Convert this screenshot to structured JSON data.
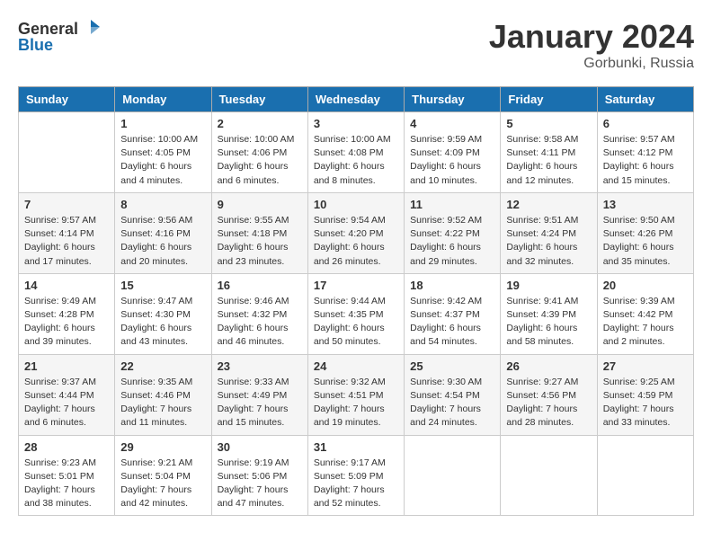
{
  "header": {
    "logo_general": "General",
    "logo_blue": "Blue",
    "month_year": "January 2024",
    "location": "Gorbunki, Russia"
  },
  "days_of_week": [
    "Sunday",
    "Monday",
    "Tuesday",
    "Wednesday",
    "Thursday",
    "Friday",
    "Saturday"
  ],
  "weeks": [
    [
      {
        "day": "",
        "sunrise": "",
        "sunset": "",
        "daylight": ""
      },
      {
        "day": "1",
        "sunrise": "Sunrise: 10:00 AM",
        "sunset": "Sunset: 4:05 PM",
        "daylight": "Daylight: 6 hours and 4 minutes."
      },
      {
        "day": "2",
        "sunrise": "Sunrise: 10:00 AM",
        "sunset": "Sunset: 4:06 PM",
        "daylight": "Daylight: 6 hours and 6 minutes."
      },
      {
        "day": "3",
        "sunrise": "Sunrise: 10:00 AM",
        "sunset": "Sunset: 4:08 PM",
        "daylight": "Daylight: 6 hours and 8 minutes."
      },
      {
        "day": "4",
        "sunrise": "Sunrise: 9:59 AM",
        "sunset": "Sunset: 4:09 PM",
        "daylight": "Daylight: 6 hours and 10 minutes."
      },
      {
        "day": "5",
        "sunrise": "Sunrise: 9:58 AM",
        "sunset": "Sunset: 4:11 PM",
        "daylight": "Daylight: 6 hours and 12 minutes."
      },
      {
        "day": "6",
        "sunrise": "Sunrise: 9:57 AM",
        "sunset": "Sunset: 4:12 PM",
        "daylight": "Daylight: 6 hours and 15 minutes."
      }
    ],
    [
      {
        "day": "7",
        "sunrise": "Sunrise: 9:57 AM",
        "sunset": "Sunset: 4:14 PM",
        "daylight": "Daylight: 6 hours and 17 minutes."
      },
      {
        "day": "8",
        "sunrise": "Sunrise: 9:56 AM",
        "sunset": "Sunset: 4:16 PM",
        "daylight": "Daylight: 6 hours and 20 minutes."
      },
      {
        "day": "9",
        "sunrise": "Sunrise: 9:55 AM",
        "sunset": "Sunset: 4:18 PM",
        "daylight": "Daylight: 6 hours and 23 minutes."
      },
      {
        "day": "10",
        "sunrise": "Sunrise: 9:54 AM",
        "sunset": "Sunset: 4:20 PM",
        "daylight": "Daylight: 6 hours and 26 minutes."
      },
      {
        "day": "11",
        "sunrise": "Sunrise: 9:52 AM",
        "sunset": "Sunset: 4:22 PM",
        "daylight": "Daylight: 6 hours and 29 minutes."
      },
      {
        "day": "12",
        "sunrise": "Sunrise: 9:51 AM",
        "sunset": "Sunset: 4:24 PM",
        "daylight": "Daylight: 6 hours and 32 minutes."
      },
      {
        "day": "13",
        "sunrise": "Sunrise: 9:50 AM",
        "sunset": "Sunset: 4:26 PM",
        "daylight": "Daylight: 6 hours and 35 minutes."
      }
    ],
    [
      {
        "day": "14",
        "sunrise": "Sunrise: 9:49 AM",
        "sunset": "Sunset: 4:28 PM",
        "daylight": "Daylight: 6 hours and 39 minutes."
      },
      {
        "day": "15",
        "sunrise": "Sunrise: 9:47 AM",
        "sunset": "Sunset: 4:30 PM",
        "daylight": "Daylight: 6 hours and 43 minutes."
      },
      {
        "day": "16",
        "sunrise": "Sunrise: 9:46 AM",
        "sunset": "Sunset: 4:32 PM",
        "daylight": "Daylight: 6 hours and 46 minutes."
      },
      {
        "day": "17",
        "sunrise": "Sunrise: 9:44 AM",
        "sunset": "Sunset: 4:35 PM",
        "daylight": "Daylight: 6 hours and 50 minutes."
      },
      {
        "day": "18",
        "sunrise": "Sunrise: 9:42 AM",
        "sunset": "Sunset: 4:37 PM",
        "daylight": "Daylight: 6 hours and 54 minutes."
      },
      {
        "day": "19",
        "sunrise": "Sunrise: 9:41 AM",
        "sunset": "Sunset: 4:39 PM",
        "daylight": "Daylight: 6 hours and 58 minutes."
      },
      {
        "day": "20",
        "sunrise": "Sunrise: 9:39 AM",
        "sunset": "Sunset: 4:42 PM",
        "daylight": "Daylight: 7 hours and 2 minutes."
      }
    ],
    [
      {
        "day": "21",
        "sunrise": "Sunrise: 9:37 AM",
        "sunset": "Sunset: 4:44 PM",
        "daylight": "Daylight: 7 hours and 6 minutes."
      },
      {
        "day": "22",
        "sunrise": "Sunrise: 9:35 AM",
        "sunset": "Sunset: 4:46 PM",
        "daylight": "Daylight: 7 hours and 11 minutes."
      },
      {
        "day": "23",
        "sunrise": "Sunrise: 9:33 AM",
        "sunset": "Sunset: 4:49 PM",
        "daylight": "Daylight: 7 hours and 15 minutes."
      },
      {
        "day": "24",
        "sunrise": "Sunrise: 9:32 AM",
        "sunset": "Sunset: 4:51 PM",
        "daylight": "Daylight: 7 hours and 19 minutes."
      },
      {
        "day": "25",
        "sunrise": "Sunrise: 9:30 AM",
        "sunset": "Sunset: 4:54 PM",
        "daylight": "Daylight: 7 hours and 24 minutes."
      },
      {
        "day": "26",
        "sunrise": "Sunrise: 9:27 AM",
        "sunset": "Sunset: 4:56 PM",
        "daylight": "Daylight: 7 hours and 28 minutes."
      },
      {
        "day": "27",
        "sunrise": "Sunrise: 9:25 AM",
        "sunset": "Sunset: 4:59 PM",
        "daylight": "Daylight: 7 hours and 33 minutes."
      }
    ],
    [
      {
        "day": "28",
        "sunrise": "Sunrise: 9:23 AM",
        "sunset": "Sunset: 5:01 PM",
        "daylight": "Daylight: 7 hours and 38 minutes."
      },
      {
        "day": "29",
        "sunrise": "Sunrise: 9:21 AM",
        "sunset": "Sunset: 5:04 PM",
        "daylight": "Daylight: 7 hours and 42 minutes."
      },
      {
        "day": "30",
        "sunrise": "Sunrise: 9:19 AM",
        "sunset": "Sunset: 5:06 PM",
        "daylight": "Daylight: 7 hours and 47 minutes."
      },
      {
        "day": "31",
        "sunrise": "Sunrise: 9:17 AM",
        "sunset": "Sunset: 5:09 PM",
        "daylight": "Daylight: 7 hours and 52 minutes."
      },
      {
        "day": "",
        "sunrise": "",
        "sunset": "",
        "daylight": ""
      },
      {
        "day": "",
        "sunrise": "",
        "sunset": "",
        "daylight": ""
      },
      {
        "day": "",
        "sunrise": "",
        "sunset": "",
        "daylight": ""
      }
    ]
  ]
}
